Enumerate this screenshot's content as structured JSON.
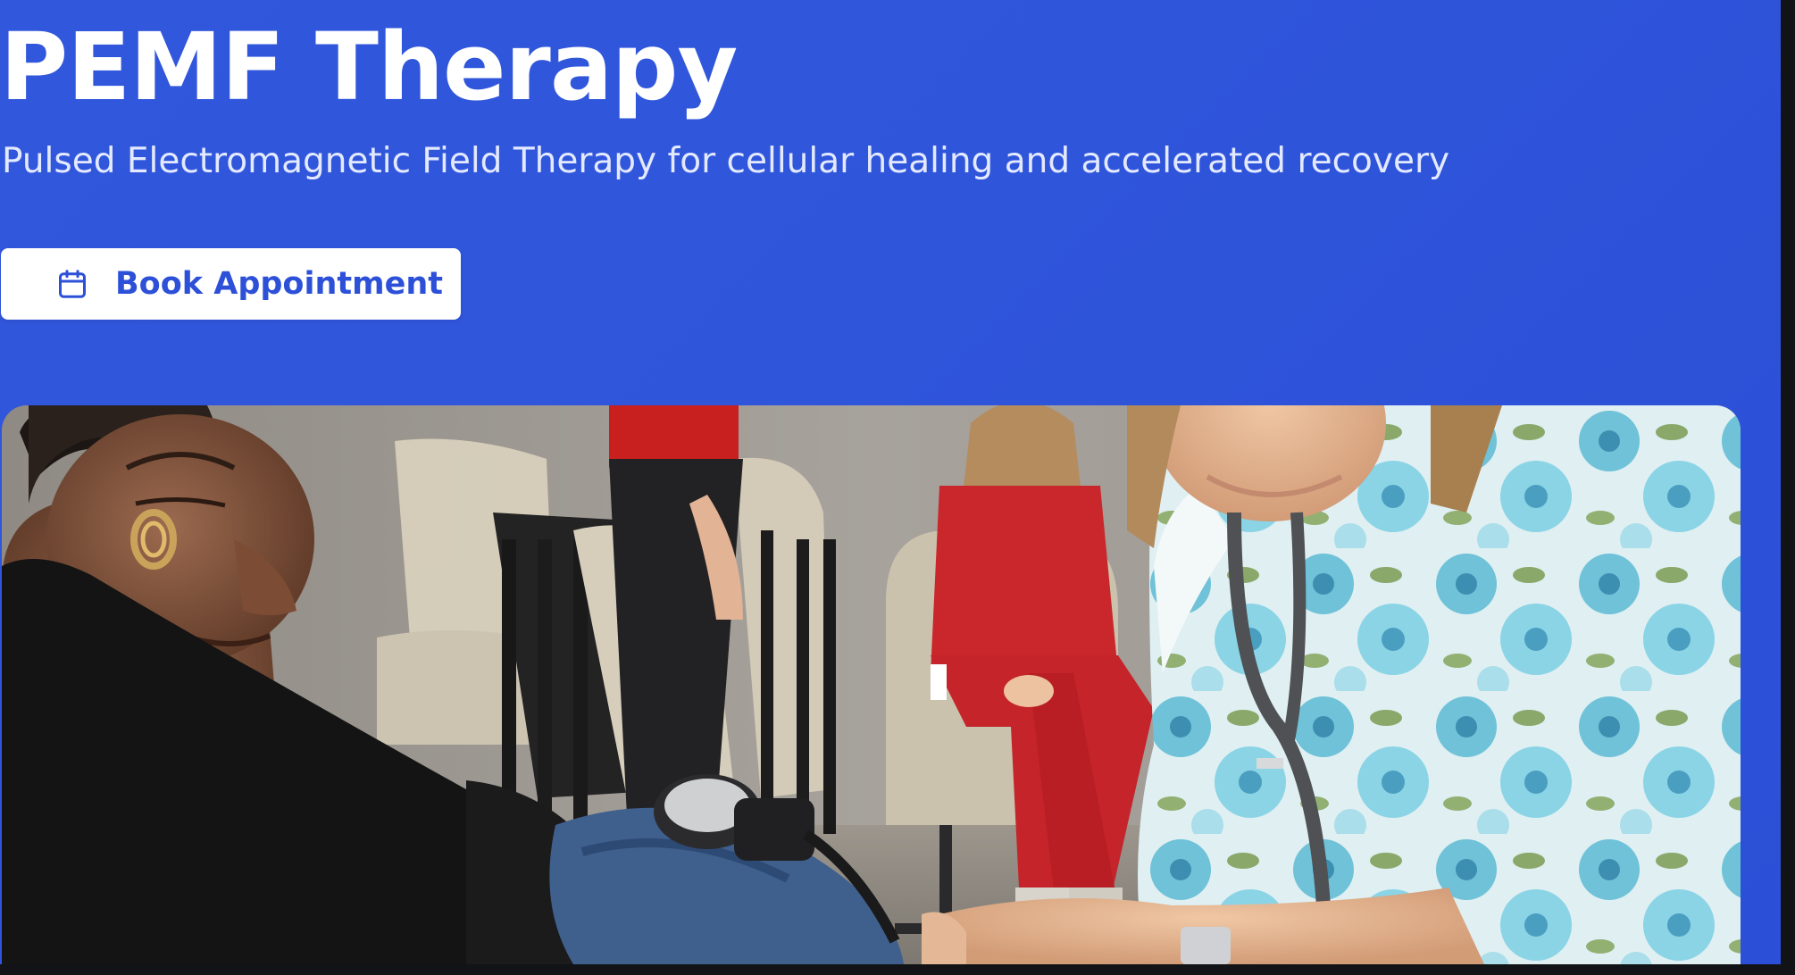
{
  "hero": {
    "title": "PEMF Therapy",
    "subtitle": "Pulsed Electromagnetic Field Therapy for cellular healing and accelerated recovery",
    "cta": {
      "label": "Book Appointment",
      "icon": "calendar-icon"
    },
    "colors": {
      "background": "#2f55db",
      "button_background": "#ffffff",
      "button_text": "#2c50d8",
      "title_text": "#ffffff"
    }
  }
}
